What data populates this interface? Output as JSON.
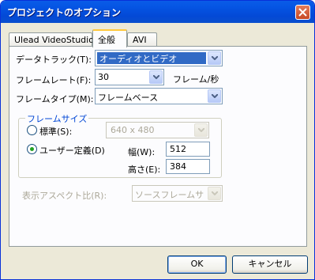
{
  "window": {
    "title": "プロジェクトのオプション"
  },
  "tabs": [
    {
      "label": "Ulead VideoStudio"
    },
    {
      "label": "全般"
    },
    {
      "label": "AVI"
    }
  ],
  "form": {
    "data_track": {
      "label": "データトラック(T):",
      "value": "オーディオとビデオ"
    },
    "frame_rate": {
      "label": "フレームレート(F):",
      "value": "30",
      "unit": "フレーム/秒"
    },
    "frame_type": {
      "label": "フレームタイプ(M):",
      "value": "フレームベース"
    },
    "frame_size": {
      "legend": "フレームサイズ",
      "standard": {
        "label": "標準(S):",
        "value": "640 x 480",
        "checked": false
      },
      "custom": {
        "label": "ユーザー定義(D)",
        "checked": true
      },
      "width": {
        "label": "幅(W):",
        "value": "512"
      },
      "height": {
        "label": "高さ(E):",
        "value": "384"
      }
    },
    "aspect": {
      "label": "表示アスペクト比(R):",
      "value": "ソースフレームサ"
    }
  },
  "buttons": {
    "ok": "OK",
    "cancel": "キャンセル"
  }
}
